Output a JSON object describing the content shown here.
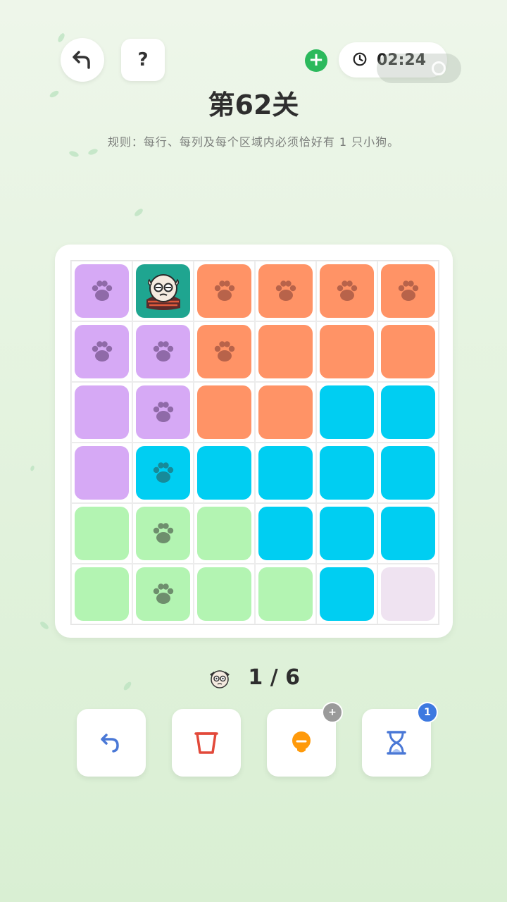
{
  "header": {
    "help_label": "?",
    "plus_label": "+",
    "timer": "02:24",
    "icons": {
      "back": "back-arrow-icon",
      "clock": "clock-icon",
      "capsule": "target-icon"
    }
  },
  "level_title": "第62关",
  "rule_text": "规则：每行、每列及每个区域内必须恰好有 1 只小狗。",
  "board": {
    "colors": {
      "purple": "#d6a9f5",
      "orange": "#ff9366",
      "blue": "#00cef2",
      "green": "#b3f4b2",
      "pink": "#efe3f1",
      "dog_bg": "#1fa590"
    },
    "rows": [
      [
        "purple",
        "dog",
        "orange",
        "orange",
        "orange",
        "orange"
      ],
      [
        "purple",
        "purple",
        "orange",
        "orange",
        "orange",
        "orange"
      ],
      [
        "purple",
        "purple",
        "orange",
        "orange",
        "blue",
        "blue"
      ],
      [
        "purple",
        "blue",
        "blue",
        "blue",
        "blue",
        "blue"
      ],
      [
        "green",
        "green",
        "green",
        "blue",
        "blue",
        "blue"
      ],
      [
        "green",
        "green",
        "green",
        "green",
        "blue",
        "pink"
      ]
    ],
    "paws": [
      [
        0,
        0
      ],
      [
        0,
        2
      ],
      [
        0,
        3
      ],
      [
        0,
        4
      ],
      [
        0,
        5
      ],
      [
        1,
        0
      ],
      [
        1,
        1
      ],
      [
        1,
        2
      ],
      [
        2,
        1
      ],
      [
        3,
        1
      ],
      [
        4,
        1
      ],
      [
        5,
        1
      ]
    ],
    "dog": [
      0,
      1
    ]
  },
  "counter": {
    "text": "1 / 6",
    "placed": 1,
    "total": 6,
    "icon": "dog-icon"
  },
  "tools": [
    {
      "name": "undo",
      "icon": "undo-icon",
      "badge": ""
    },
    {
      "name": "clear",
      "icon": "trash-icon",
      "badge": ""
    },
    {
      "name": "hint",
      "icon": "lightbulb-icon",
      "badge": "+"
    },
    {
      "name": "time",
      "icon": "hourglass-icon",
      "badge": "1"
    }
  ]
}
